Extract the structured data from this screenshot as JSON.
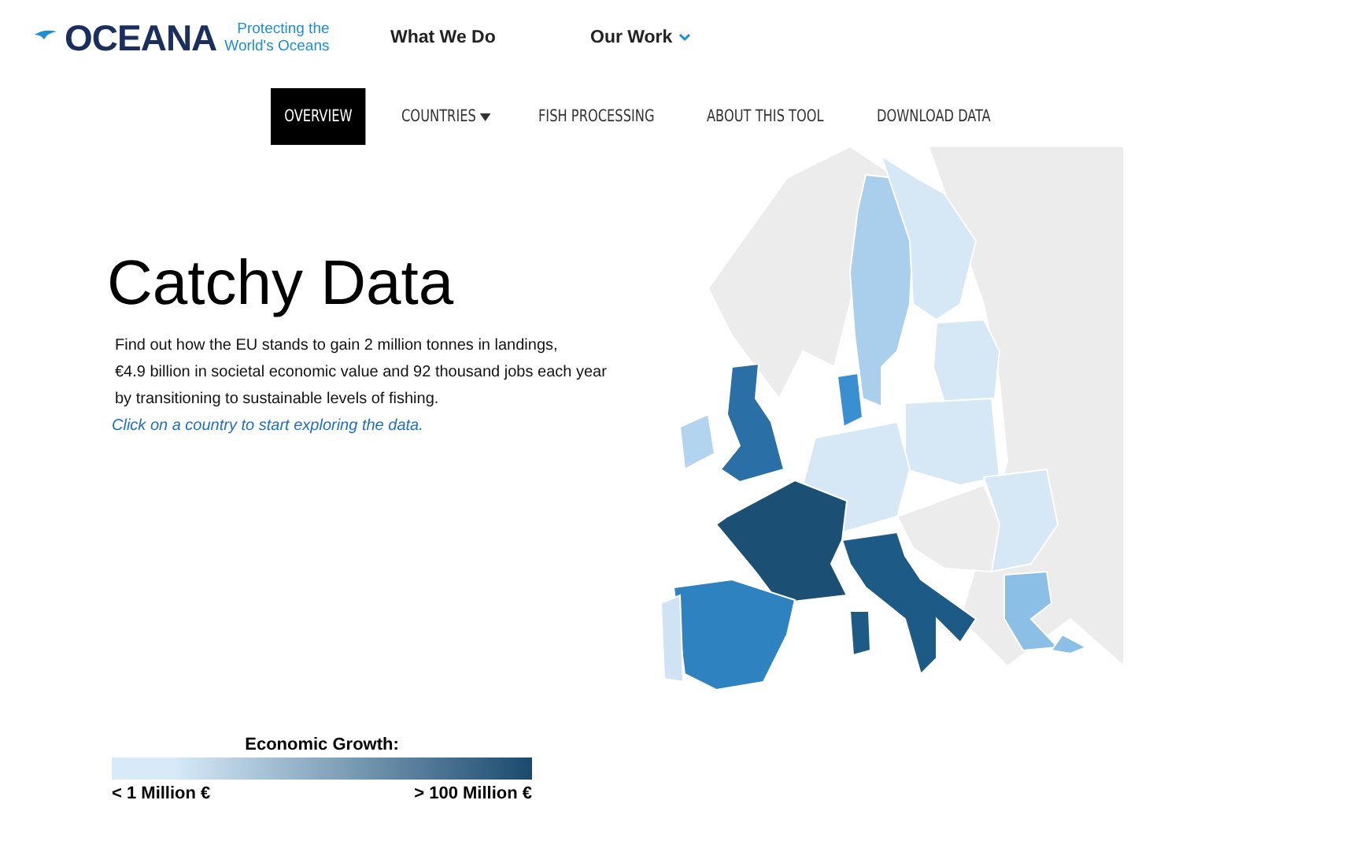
{
  "header": {
    "logo": {
      "name": "OCEANA",
      "tagline_line1": "Protecting the",
      "tagline_line2": "World's Oceans"
    },
    "menu": [
      {
        "label": "What We Do",
        "dropdown": false
      },
      {
        "label": "Our Work",
        "dropdown": true
      }
    ]
  },
  "tool_nav": [
    {
      "label": "OVERVIEW",
      "selected": true,
      "dropdown": false
    },
    {
      "label": "COUNTRIES",
      "selected": false,
      "dropdown": true
    },
    {
      "label": "FISH PROCESSING",
      "selected": false,
      "dropdown": false
    },
    {
      "label": "ABOUT THIS TOOL",
      "selected": false,
      "dropdown": false
    },
    {
      "label": "DOWNLOAD DATA",
      "selected": false,
      "dropdown": false
    }
  ],
  "hero": {
    "title": "Catchy Data",
    "intro_lines": [
      "Find out how the EU stands to gain 2 million tonnes in landings,",
      "€4.9 billion in societal economic value and 92 thousand jobs each year",
      "by transitioning to sustainable levels of fishing."
    ],
    "hint": "Click on a country to start exploring the data."
  },
  "legend": {
    "title": "Economic Growth:",
    "min_label": "< 1 Million €",
    "max_label": "> 100 Million €"
  }
}
